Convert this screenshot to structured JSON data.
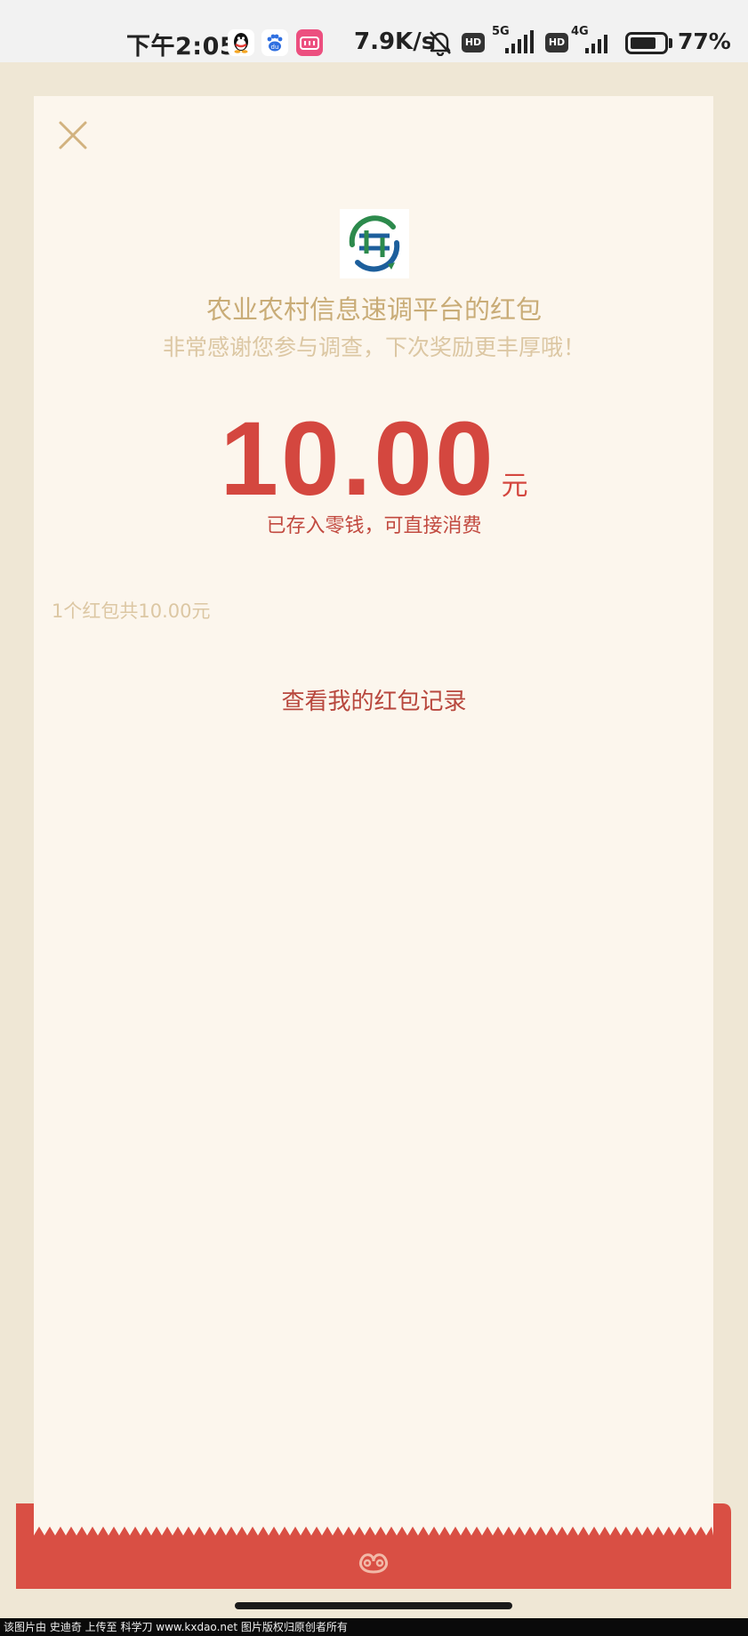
{
  "status_bar": {
    "time": "下午2:05",
    "net_speed": "7.9K/s",
    "hd_badge_1": "HD",
    "network_1": "5G",
    "hd_badge_2": "HD",
    "network_2": "4G",
    "battery_percent": "77%",
    "battery_level": 0.77,
    "icons": [
      "qq-icon",
      "baidu-icon",
      "pink-app-icon",
      "bell-muted-icon",
      "signal-icon",
      "battery-icon"
    ]
  },
  "envelope": {
    "close_icon": "close-icon",
    "logo_icon": "platform-logo",
    "sender_title": "农业农村信息速调平台的红包",
    "sender_message": "非常感谢您参与调查，下次奖励更丰厚哦！",
    "amount": "10.00",
    "amount_unit": "元",
    "stored_note": "已存入零钱，可直接消费",
    "packet_summary": "1个红包共10.00元",
    "view_records_label": "查看我的红包记录"
  },
  "bottom_bar": {
    "icon": "wechat-pay-logo-icon"
  },
  "watermark": {
    "text": "该图片由 史迪奇 上传至 科学刀 www.kxdao.net 图片版权归原创者所有"
  },
  "colors": {
    "page_background": "#efe7d5",
    "card_background": "#fcf6ed",
    "accent_red": "#d4473f",
    "gold_text": "#c9ac77",
    "bottom_red": "#d94f44"
  }
}
